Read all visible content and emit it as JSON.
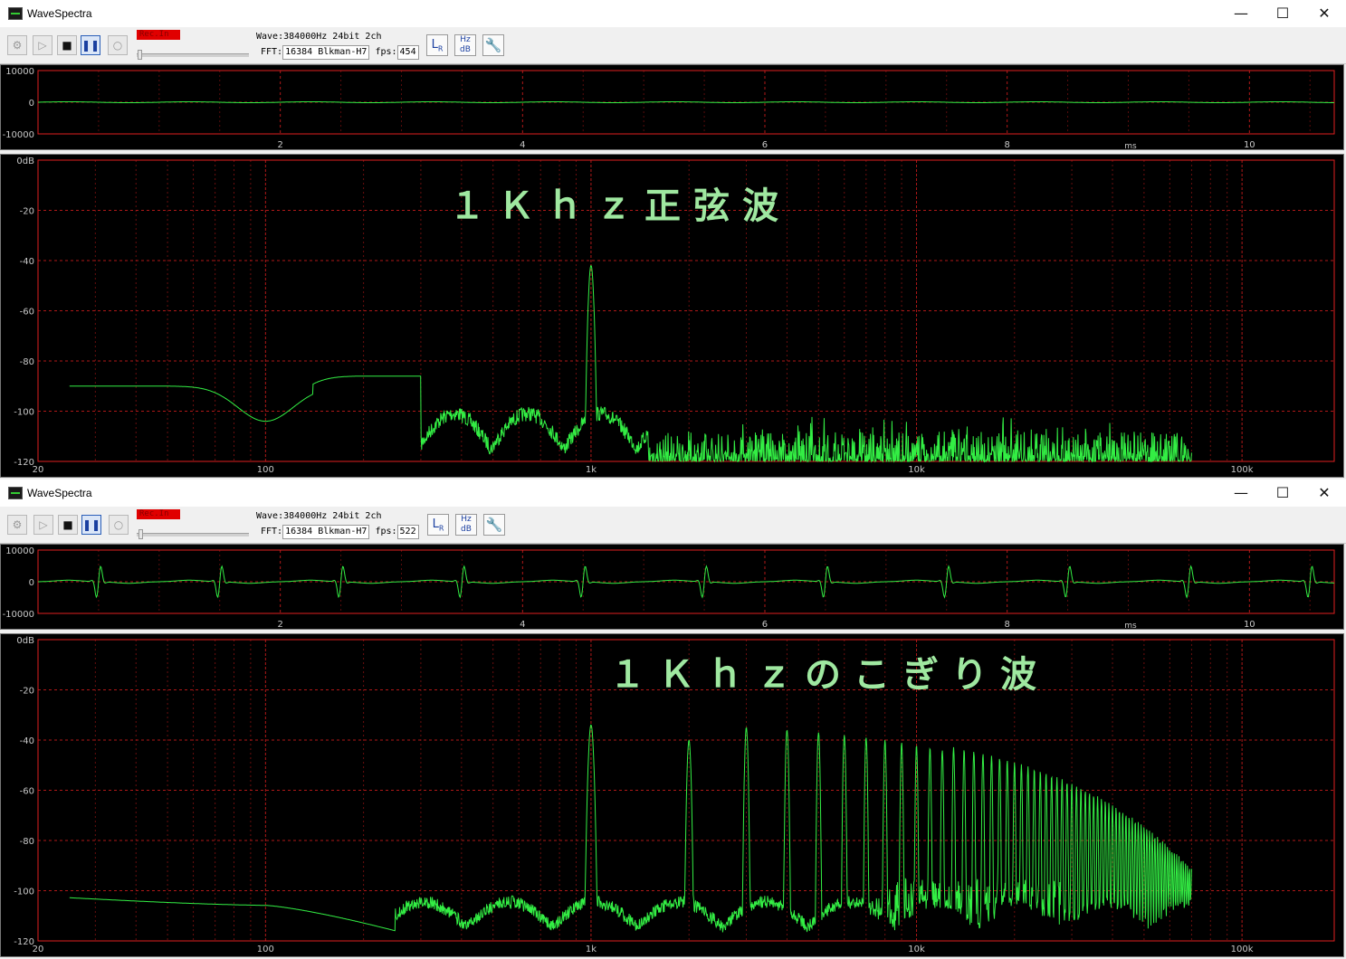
{
  "windows": [
    {
      "title": "WaveSpectra",
      "rec_label": "Rec.In",
      "wave_label": "Wave:",
      "wave_value": "384000Hz 24bit 2ch",
      "fft_label": "FFT:",
      "fft_value": "16384 Blkman-H7",
      "fps_label": "fps:",
      "fps_value": "454",
      "overlay": "１Ｋｈｚ正弦波",
      "waveform": {
        "y_ticks": [
          "10000",
          "0",
          "-10000"
        ],
        "x_ticks": [
          "2",
          "4",
          "6",
          "8",
          "10"
        ],
        "x_unit": "ms",
        "x_range": [
          0,
          10.7
        ],
        "y_range": [
          -10000,
          10000
        ]
      },
      "spectrum": {
        "y_ticks": [
          "0dB",
          "-20",
          "-40",
          "-60",
          "-80",
          "-100",
          "-120"
        ],
        "x_ticks": [
          "20",
          "100",
          "1k",
          "10k",
          "100k"
        ],
        "x_scale": "log",
        "x_range_hz": [
          20,
          192000
        ],
        "y_range_db": [
          -120,
          0
        ]
      }
    },
    {
      "title": "WaveSpectra",
      "rec_label": "Rec.In",
      "wave_label": "Wave:",
      "wave_value": "384000Hz 24bit 2ch",
      "fft_label": "FFT:",
      "fft_value": "16384 Blkman-H7",
      "fps_label": "fps:",
      "fps_value": "522",
      "overlay": "１Ｋｈｚのこぎり波",
      "waveform": {
        "y_ticks": [
          "10000",
          "0",
          "-10000"
        ],
        "x_ticks": [
          "2",
          "4",
          "6",
          "8",
          "10"
        ],
        "x_unit": "ms",
        "x_range": [
          0,
          10.7
        ],
        "y_range": [
          -10000,
          10000
        ]
      },
      "spectrum": {
        "y_ticks": [
          "0dB",
          "-20",
          "-40",
          "-60",
          "-80",
          "-100",
          "-120"
        ],
        "x_ticks": [
          "20",
          "100",
          "1k",
          "10k",
          "100k"
        ],
        "x_scale": "log",
        "x_range_hz": [
          20,
          192000
        ],
        "y_range_db": [
          -120,
          0
        ]
      }
    }
  ],
  "colors": {
    "trace": "#33ee44",
    "grid": "#b01818",
    "frame": "#e02020",
    "background": "#000000",
    "axis_text": "#c8c8c8",
    "overlay_text": "#9fe8a0"
  },
  "icons": [
    "settings-icon",
    "play-icon",
    "stop-icon",
    "pause-icon",
    "record-icon",
    "lr-icon",
    "hz-db-icon",
    "wrench-icon"
  ]
}
